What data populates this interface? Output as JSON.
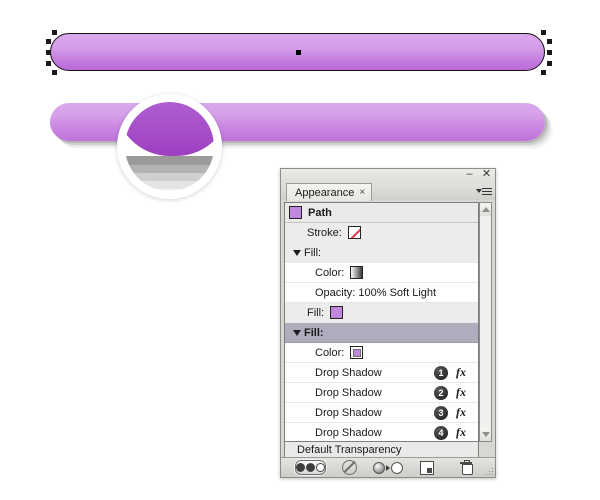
{
  "canvas": {
    "artwork_name": "rounded-bar-artwork",
    "bar_fill_top": "#dba9ee",
    "bar_fill_bottom": "#bb6ad9",
    "magnifier_label": "loupe-zoom-preview"
  },
  "panel": {
    "tab_label": "Appearance",
    "tab_close_glyph": "×",
    "minimize_glyph": "–",
    "close_glyph": "✕",
    "rows": [
      {
        "name": "path-header",
        "label": "Path",
        "swatch": "purple",
        "style": "head"
      },
      {
        "name": "stroke-row",
        "label": "Stroke:",
        "swatch": "none",
        "style": "alt"
      },
      {
        "name": "fill-group-1",
        "label": "Fill:",
        "swatch": null,
        "style": "alt"
      },
      {
        "name": "fill-1-color",
        "label": "Color:",
        "swatch": "grad",
        "style": "plain"
      },
      {
        "name": "fill-1-opacity",
        "label": "Opacity: 100% Soft Light",
        "swatch": null,
        "style": "plain"
      },
      {
        "name": "fill-2-summary",
        "label": "Fill:",
        "swatch": "purple",
        "style": "alt"
      },
      {
        "name": "fill-group-2",
        "label": "Fill:",
        "swatch": null,
        "style": "sel"
      },
      {
        "name": "fill-2-color",
        "label": "Color:",
        "swatch": "dbl",
        "style": "plain"
      }
    ],
    "effects": [
      {
        "name": "drop-shadow-1",
        "label": "Drop Shadow",
        "badge": "1",
        "fx": "fx"
      },
      {
        "name": "drop-shadow-2",
        "label": "Drop Shadow",
        "badge": "2",
        "fx": "fx"
      },
      {
        "name": "drop-shadow-3",
        "label": "Drop Shadow",
        "badge": "3",
        "fx": "fx"
      },
      {
        "name": "drop-shadow-4",
        "label": "Drop Shadow",
        "badge": "4",
        "fx": "fx"
      }
    ],
    "footer_label": "Default Transparency",
    "toolbar": {
      "fx_toggle": "fx-visibility-toggle",
      "clear_appearance": "clear-appearance",
      "duplicate_item": "duplicate-selected-item",
      "new_art_has_basic": "add-new-fill",
      "delete_item": "delete-selected-item"
    }
  }
}
